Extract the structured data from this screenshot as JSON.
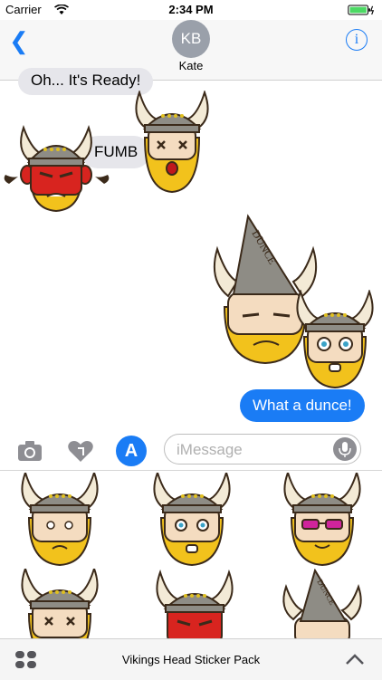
{
  "status": {
    "carrier": "Carrier",
    "time": "2:34 PM"
  },
  "header": {
    "avatar_initials": "KB",
    "contact_name": "Kate",
    "info_label": "i"
  },
  "messages": [
    {
      "text": "Oh... It's Ready!",
      "direction": "incoming"
    },
    {
      "text": "FUMB",
      "direction": "incoming"
    },
    {
      "text": "What a dunce!",
      "direction": "outgoing"
    }
  ],
  "stickers_in_chat": [
    {
      "name": "angry-red-viking"
    },
    {
      "name": "dizzy-viking"
    },
    {
      "name": "dunce-viking",
      "hat_text": "DUNCE"
    },
    {
      "name": "scared-viking"
    }
  ],
  "input": {
    "placeholder": "iMessage",
    "app_store_icon": "A"
  },
  "drawer_stickers": [
    {
      "name": "worried-viking"
    },
    {
      "name": "surprised-viking"
    },
    {
      "name": "sunglasses-viking"
    },
    {
      "name": "dizzy-viking"
    },
    {
      "name": "angry-red-viking"
    },
    {
      "name": "dunce-viking",
      "hat_text": "DUNCE"
    }
  ],
  "bottom": {
    "pack_title": "Vikings Head Sticker Pack"
  },
  "colors": {
    "accent": "#1a7cf5",
    "incoming_bubble": "#e6e6eb",
    "beard": "#f2c21c"
  }
}
